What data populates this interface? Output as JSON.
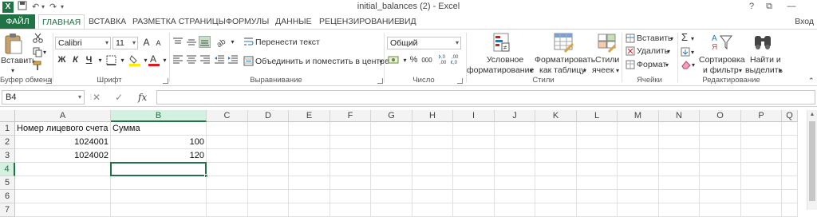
{
  "window": {
    "title": "initial_balances (2) - Excel",
    "help_label": "?",
    "restore_label": "⧉",
    "minimize_label": "—"
  },
  "tabs": [
    {
      "label": "ФАЙЛ"
    },
    {
      "label": "ГЛАВНАЯ"
    },
    {
      "label": "ВСТАВКА"
    },
    {
      "label": "РАЗМЕТКА СТРАНИЦЫ"
    },
    {
      "label": "ФОРМУЛЫ"
    },
    {
      "label": "ДАННЫЕ"
    },
    {
      "label": "РЕЦЕНЗИРОВАНИЕ"
    },
    {
      "label": "ВИД"
    }
  ],
  "signin": "Вход",
  "ribbon": {
    "clipboard": {
      "paste_label": "Вставить",
      "group_label": "Буфер обмена"
    },
    "font": {
      "name": "Calibri",
      "size": "11",
      "bold": "Ж",
      "italic": "К",
      "underline": "Ч",
      "grow": "A",
      "shrink": "A",
      "group_label": "Шрифт"
    },
    "alignment": {
      "wrap_label": "Перенести текст",
      "merge_label": "Объединить и поместить в центре",
      "group_label": "Выравнивание"
    },
    "number": {
      "format": "Общий",
      "percent": "%",
      "thousands": "000",
      "group_label": "Число"
    },
    "styles": {
      "conditional_line1": "Условное",
      "conditional_line2": "форматирование",
      "table_line1": "Форматировать",
      "table_line2": "как таблицу",
      "cell_line1": "Стили",
      "cell_line2": "ячеек",
      "group_label": "Стили"
    },
    "cells": {
      "insert_label": "Вставить",
      "delete_label": "Удалить",
      "format_label": "Формат",
      "group_label": "Ячейки"
    },
    "editing": {
      "sort_line1": "Сортировка",
      "sort_line2": "и фильтр",
      "find_line1": "Найти и",
      "find_line2": "выделить",
      "group_label": "Редактирование"
    }
  },
  "formula_bar": {
    "name_box": "B4",
    "cancel": "✕",
    "enter": "✓",
    "fx": "fx",
    "value": ""
  },
  "sheet": {
    "columns": [
      "A",
      "B",
      "C",
      "D",
      "E",
      "F",
      "G",
      "H",
      "I",
      "J",
      "K",
      "L",
      "M",
      "N",
      "O",
      "P",
      "Q"
    ],
    "rows": [
      "1",
      "2",
      "3",
      "4",
      "5",
      "6",
      "7"
    ],
    "selected_cell": "B4",
    "cells": {
      "A1": "Номер лицевого счета",
      "B1": "Сумма",
      "A2": "1024001",
      "B2": "100",
      "A3": "1024002",
      "B3": "120"
    }
  },
  "colors": {
    "accent": "#217346",
    "selected_header_bg": "#d3f0e0"
  }
}
